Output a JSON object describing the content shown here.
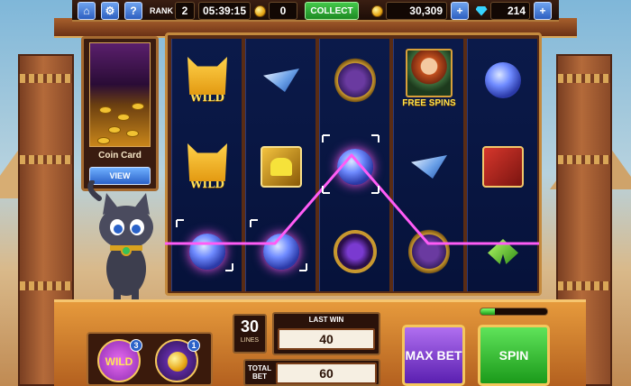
{
  "top_bar": {
    "home_icon": "home-icon",
    "settings_icon": "gear-icon",
    "help_label": "?",
    "rank_label": "RANK",
    "rank_value": "2",
    "timer": "05:39:15",
    "collect_coins": "0",
    "collect_label": "COLLECT",
    "coin_balance": "30,309",
    "gem_balance": "214",
    "add_label": "+"
  },
  "coin_card": {
    "title": "Coin Card",
    "view_label": "VIEW"
  },
  "reels": [
    [
      {
        "type": "wild-cat",
        "label": "WILD"
      },
      {
        "type": "wild-cat",
        "label": "WILD"
      },
      {
        "type": "orb",
        "label": ""
      }
    ],
    [
      {
        "type": "pyramid",
        "label": ""
      },
      {
        "type": "golden-tile",
        "label": ""
      },
      {
        "type": "orb",
        "label": ""
      }
    ],
    [
      {
        "type": "scarab",
        "label": ""
      },
      {
        "type": "orb",
        "label": ""
      },
      {
        "type": "orbital",
        "label": ""
      }
    ],
    [
      {
        "type": "free-spins",
        "label": "FREE SPINS"
      },
      {
        "type": "pyramid",
        "label": ""
      },
      {
        "type": "scarab-orb",
        "label": ""
      }
    ],
    [
      {
        "type": "yarn-orb",
        "label": ""
      },
      {
        "type": "red-tile",
        "label": ""
      },
      {
        "type": "leaf",
        "label": ""
      }
    ]
  ],
  "console": {
    "lines_value": "30",
    "lines_label": "LINES",
    "last_win_label": "LAST WIN",
    "last_win_value": "40",
    "total_bet_label": "TOTAL BET",
    "total_bet_value": "60",
    "max_bet_label": "MAX BET",
    "spin_label": "SPIN",
    "spin_progress": 0.22
  },
  "boosts": [
    {
      "name": "wild-boost",
      "label": "WILD",
      "count": "3"
    },
    {
      "name": "coin-boost",
      "label": "",
      "count": "1"
    }
  ],
  "colors": {
    "win_line": "#ff5cf6",
    "collect_green": "#2fb336",
    "spin_green": "#2bb52a",
    "max_bet_purple": "#8a3fe0",
    "reel_bg": "#0b1a4a",
    "frame_gold": "#c48a3e"
  }
}
